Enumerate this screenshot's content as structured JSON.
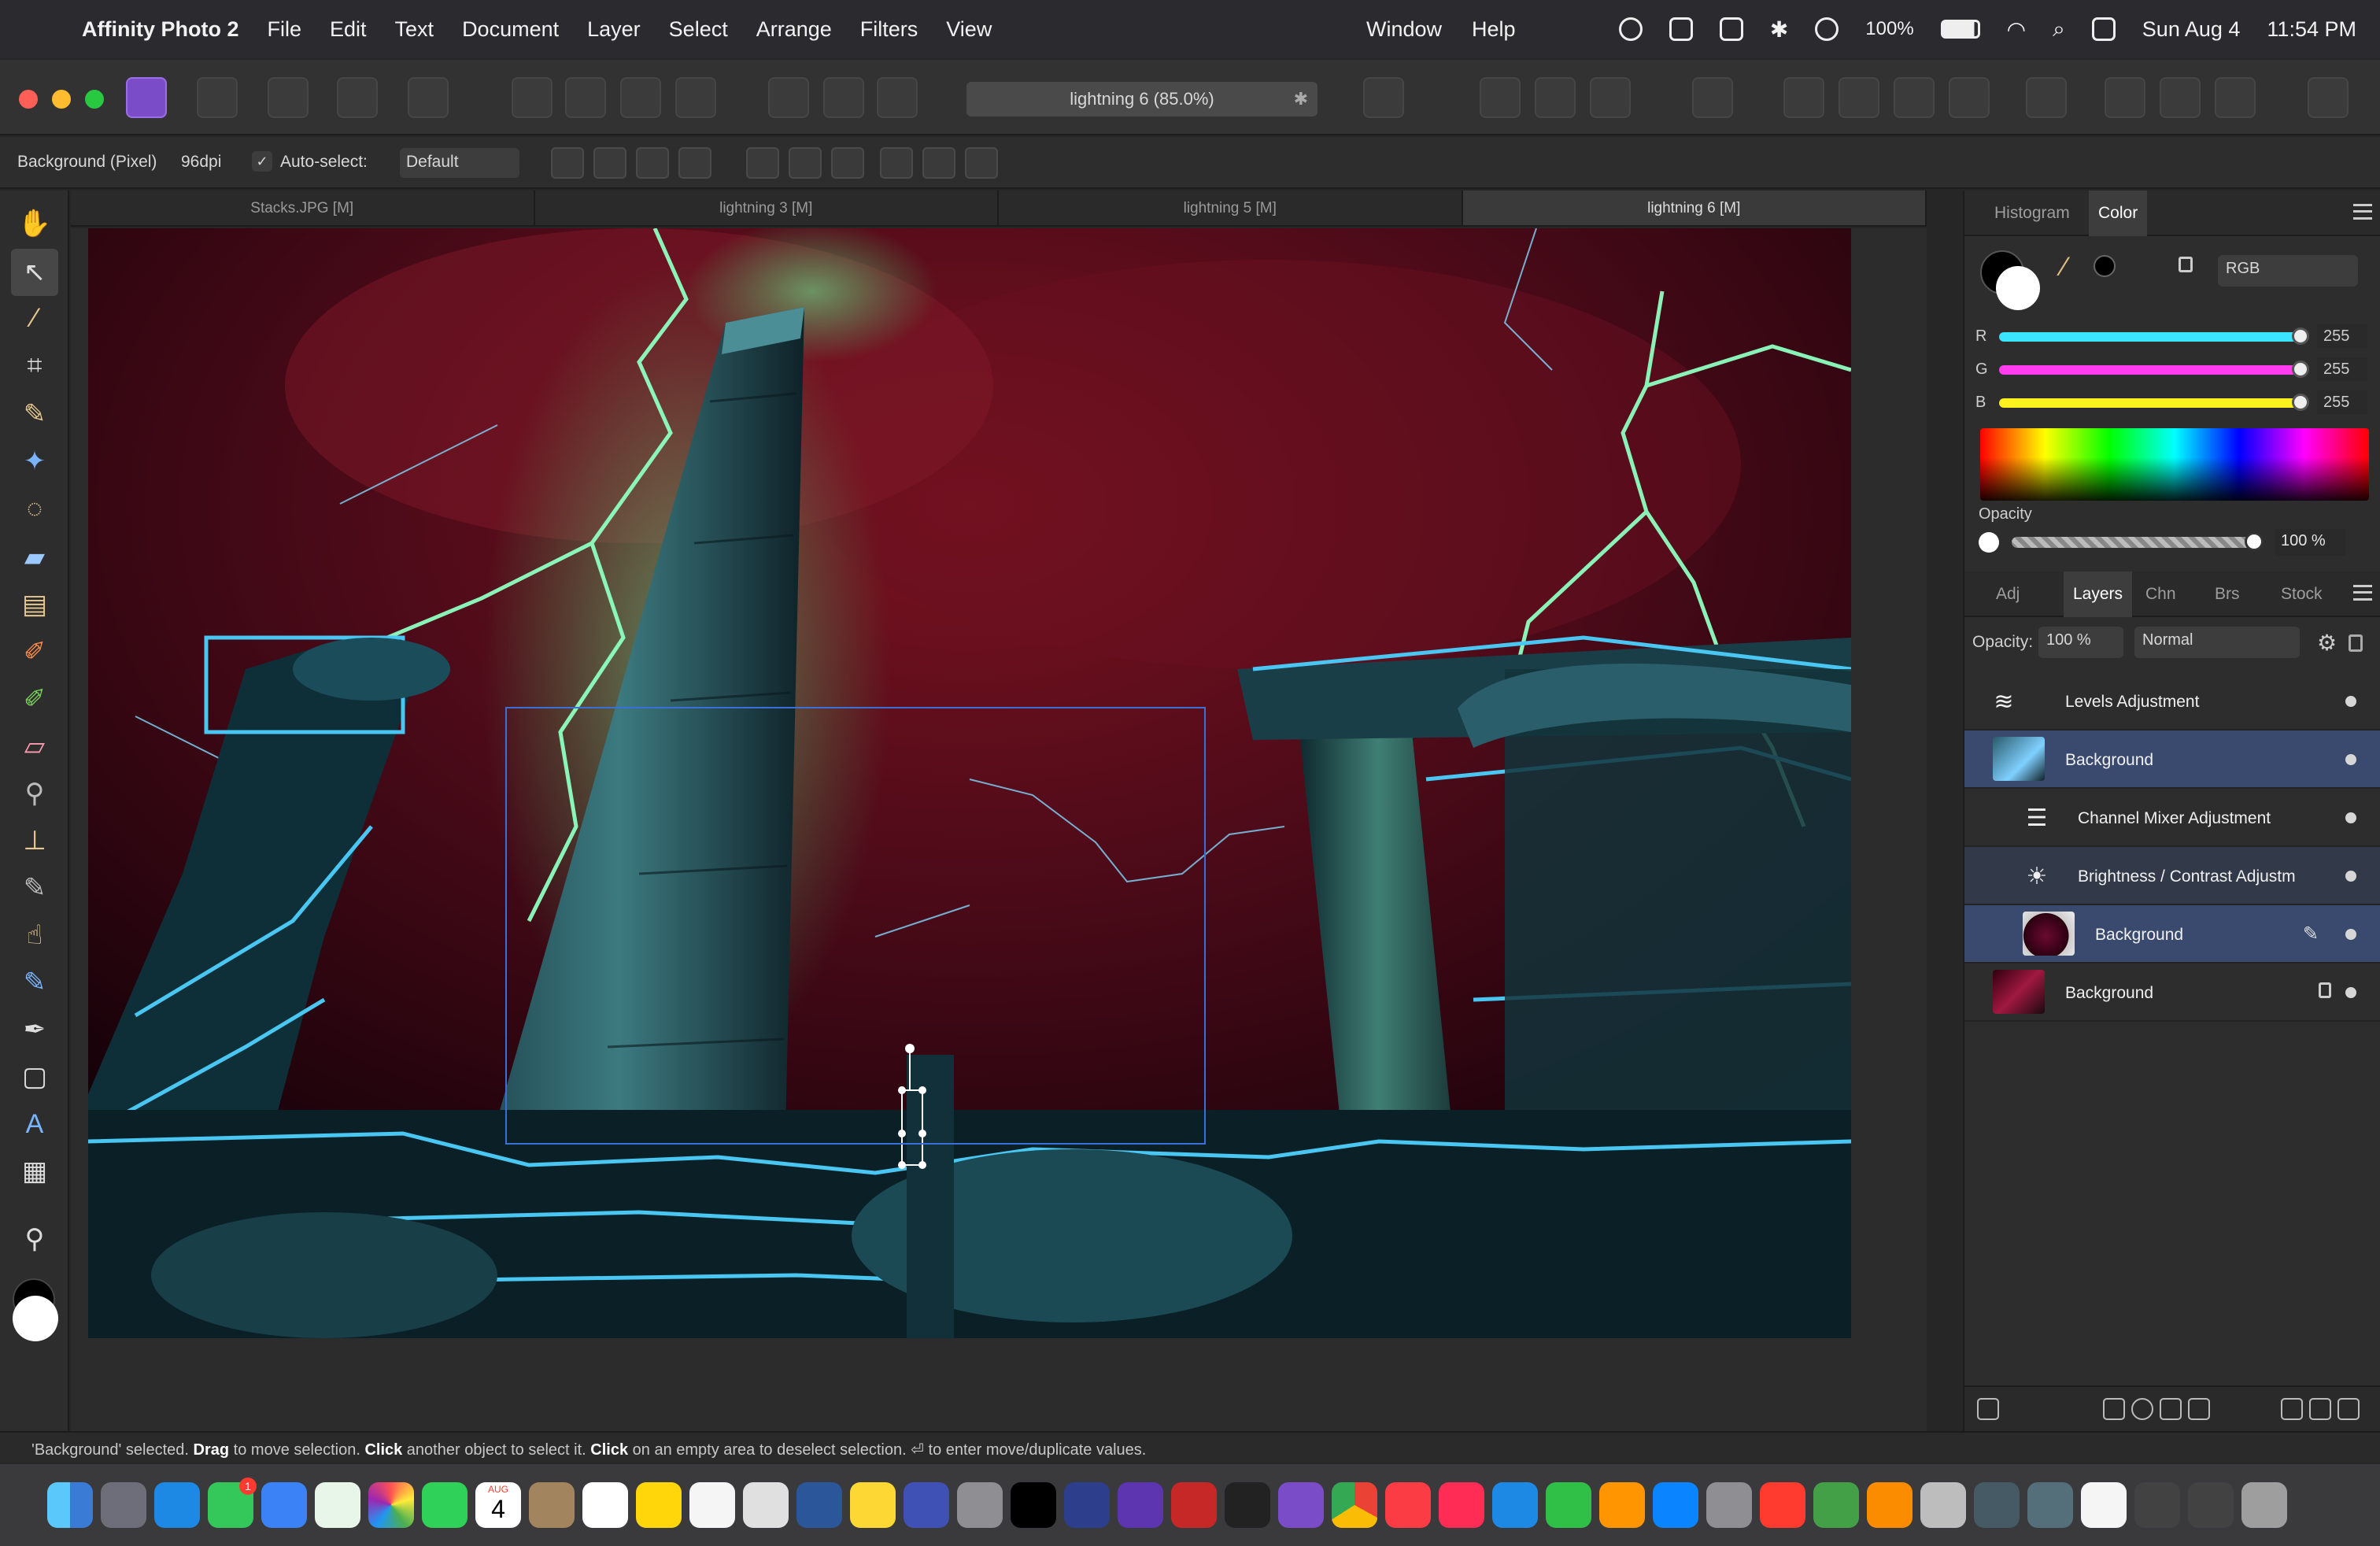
{
  "menubar": {
    "app_name": "Affinity Photo 2",
    "items": [
      "File",
      "Edit",
      "Text",
      "Document",
      "Layer",
      "Select",
      "Arrange",
      "Filters",
      "View"
    ],
    "right_items": [
      "Window",
      "Help"
    ],
    "battery": "100%",
    "date": "Sun Aug 4",
    "time": "11:54 PM"
  },
  "toolbar": {
    "document_title": "lightning 6 (85.0%)",
    "pin_symbol": "✱"
  },
  "context_toolbar": {
    "layer_type": "Background (Pixel)",
    "dpi": "96dpi",
    "auto_select_label": "Auto-select:",
    "auto_select_value": "Default",
    "auto_select_checked": "✓"
  },
  "doc_tabs": [
    "Stacks.JPG [M]",
    "lightning 3 [M]",
    "lightning 5 [M]",
    "lightning 6 [M]"
  ],
  "color_panel": {
    "tabs": [
      "Histogram",
      "Color"
    ],
    "active_tab": "Color",
    "mode": "RGB",
    "r_label": "R",
    "r_value": "255",
    "g_label": "G",
    "g_value": "255",
    "b_label": "B",
    "b_value": "255",
    "opacity_label": "Opacity",
    "opacity_value": "100 %",
    "colors": {
      "r_track": "#3be4ff",
      "g_track": "#ff3cf0",
      "b_track": "#fff020"
    }
  },
  "layers_panel": {
    "tabs": [
      "Adj",
      "Layers",
      "Chn",
      "Brs",
      "Stock"
    ],
    "active_tab": "Layers",
    "opacity_label": "Opacity:",
    "opacity_value": "100 %",
    "blend_mode": "Normal",
    "layers": [
      {
        "name": "Levels Adjustment"
      },
      {
        "name": "Background"
      },
      {
        "name": "Channel Mixer Adjustment"
      },
      {
        "name": "Brightness / Contrast Adjustm"
      },
      {
        "name": "Background"
      },
      {
        "name": "Background"
      }
    ]
  },
  "status": {
    "part1": "'Background' selected. ",
    "bold1": "Drag",
    "part2": " to move selection. ",
    "bold2": "Click",
    "part3": " another object to select it. ",
    "bold3": "Click",
    "part4": " on an empty area to deselect selection. ⏎ to enter move/duplicate values."
  },
  "dock": {
    "calendar_month": "AUG",
    "calendar_day": "4",
    "messages_badge": "1"
  },
  "accent": "#3b6fd8"
}
